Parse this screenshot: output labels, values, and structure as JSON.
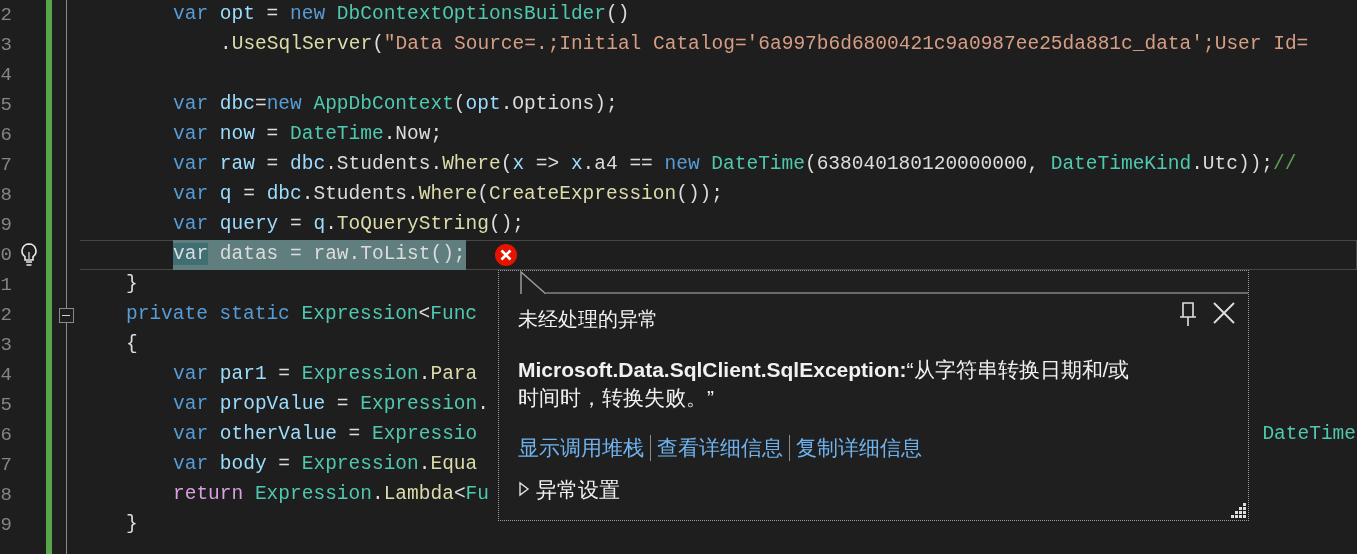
{
  "editor": {
    "lines": [
      {
        "number": "2",
        "kind": "statement",
        "tokens": [
          {
            "text": "var",
            "kind": "keyword"
          },
          {
            "text": " opt",
            "kind": "ident"
          },
          {
            "text": " = ",
            "kind": "plain"
          },
          {
            "text": "new",
            "kind": "keyword"
          },
          {
            "text": " DbContextOptionsBuilder",
            "kind": "type"
          },
          {
            "text": "()",
            "kind": "plain"
          }
        ]
      },
      {
        "number": "3",
        "kind": "continuation",
        "tokens": [
          {
            "text": ".",
            "kind": "plain"
          },
          {
            "text": "UseSqlServer",
            "kind": "method"
          },
          {
            "text": "(",
            "kind": "plain"
          },
          {
            "text": "\"Data Source=.;Initial Catalog='6a997b6d6800421c9a0987ee25da881c_data';User Id=",
            "kind": "string"
          }
        ]
      },
      {
        "number": "4",
        "kind": "blank"
      },
      {
        "number": "5",
        "kind": "statement",
        "tokens": [
          {
            "text": "var",
            "kind": "keyword"
          },
          {
            "text": " dbc",
            "kind": "ident"
          },
          {
            "text": "=",
            "kind": "plain"
          },
          {
            "text": "new",
            "kind": "keyword"
          },
          {
            "text": " AppDbContext",
            "kind": "type"
          },
          {
            "text": "(",
            "kind": "plain"
          },
          {
            "text": "opt",
            "kind": "ident"
          },
          {
            "text": ".Options);",
            "kind": "plain"
          }
        ]
      },
      {
        "number": "6",
        "kind": "statement",
        "tokens": [
          {
            "text": "var",
            "kind": "keyword"
          },
          {
            "text": " now",
            "kind": "ident"
          },
          {
            "text": " = ",
            "kind": "plain"
          },
          {
            "text": "DateTime",
            "kind": "type"
          },
          {
            "text": ".Now;",
            "kind": "plain"
          }
        ]
      },
      {
        "number": "7",
        "kind": "statement",
        "tokens": [
          {
            "text": "var",
            "kind": "keyword"
          },
          {
            "text": " raw",
            "kind": "ident"
          },
          {
            "text": " = ",
            "kind": "plain"
          },
          {
            "text": "dbc",
            "kind": "ident"
          },
          {
            "text": ".Students.",
            "kind": "plain"
          },
          {
            "text": "Where",
            "kind": "method"
          },
          {
            "text": "(",
            "kind": "plain"
          },
          {
            "text": "x",
            "kind": "ident"
          },
          {
            "text": " => ",
            "kind": "plain"
          },
          {
            "text": "x",
            "kind": "ident"
          },
          {
            "text": ".a4 == ",
            "kind": "plain"
          },
          {
            "text": "new",
            "kind": "keyword"
          },
          {
            "text": " DateTime",
            "kind": "type"
          },
          {
            "text": "(638040180120000000, ",
            "kind": "plain"
          },
          {
            "text": "DateTimeKind",
            "kind": "type"
          },
          {
            "text": ".Utc));",
            "kind": "plain"
          },
          {
            "text": "//",
            "kind": "comment"
          }
        ]
      },
      {
        "number": "8",
        "kind": "statement",
        "tokens": [
          {
            "text": "var",
            "kind": "keyword"
          },
          {
            "text": " q",
            "kind": "ident"
          },
          {
            "text": " = ",
            "kind": "plain"
          },
          {
            "text": "dbc",
            "kind": "ident"
          },
          {
            "text": ".Students.",
            "kind": "plain"
          },
          {
            "text": "Where",
            "kind": "method"
          },
          {
            "text": "(",
            "kind": "plain"
          },
          {
            "text": "CreateExpression",
            "kind": "method"
          },
          {
            "text": "());",
            "kind": "plain"
          }
        ]
      },
      {
        "number": "9",
        "kind": "statement",
        "tokens": [
          {
            "text": "var",
            "kind": "keyword"
          },
          {
            "text": " query",
            "kind": "ident"
          },
          {
            "text": " = ",
            "kind": "plain"
          },
          {
            "text": "q",
            "kind": "ident"
          },
          {
            "text": ".",
            "kind": "plain"
          },
          {
            "text": "ToQueryString",
            "kind": "method"
          },
          {
            "text": "();",
            "kind": "plain"
          }
        ]
      },
      {
        "number": "0",
        "kind": "statement",
        "current": true,
        "highlighted": true,
        "lightbulb": true,
        "error": true,
        "tokens": [
          {
            "text": "var",
            "kind": "keyword"
          },
          {
            "text": " datas = raw.ToList();",
            "kind": "plain"
          }
        ]
      },
      {
        "number": "1",
        "kind": "member",
        "tokens": [
          {
            "text": "}",
            "kind": "plain"
          }
        ]
      },
      {
        "number": "2",
        "kind": "member",
        "fold_expanded": true,
        "tokens": [
          {
            "text": "private static",
            "kind": "keyword"
          },
          {
            "text": " Expression",
            "kind": "type"
          },
          {
            "text": "<",
            "kind": "plain"
          },
          {
            "text": "Func",
            "kind": "type"
          }
        ]
      },
      {
        "number": "3",
        "kind": "member",
        "tokens": [
          {
            "text": "{",
            "kind": "plain"
          }
        ]
      },
      {
        "number": "4",
        "kind": "statement",
        "tokens": [
          {
            "text": "var",
            "kind": "keyword"
          },
          {
            "text": " par1",
            "kind": "ident"
          },
          {
            "text": " = ",
            "kind": "plain"
          },
          {
            "text": "Expression",
            "kind": "type"
          },
          {
            "text": ".",
            "kind": "plain"
          },
          {
            "text": "Para",
            "kind": "method"
          }
        ]
      },
      {
        "number": "5",
        "kind": "statement",
        "tokens": [
          {
            "text": "var",
            "kind": "keyword"
          },
          {
            "text": " propValue",
            "kind": "ident"
          },
          {
            "text": " = ",
            "kind": "plain"
          },
          {
            "text": "Expression",
            "kind": "type"
          },
          {
            "text": ".",
            "kind": "plain"
          }
        ]
      },
      {
        "number": "6",
        "kind": "statement",
        "tokens": [
          {
            "text": "var",
            "kind": "keyword"
          },
          {
            "text": " otherValue",
            "kind": "ident"
          },
          {
            "text": " = ",
            "kind": "plain"
          },
          {
            "text": "Expressio",
            "kind": "type"
          }
        ],
        "tail": {
          "text": "DateTime",
          "kind": "type"
        }
      },
      {
        "number": "7",
        "kind": "statement",
        "tokens": [
          {
            "text": "var",
            "kind": "keyword"
          },
          {
            "text": " body",
            "kind": "ident"
          },
          {
            "text": " = ",
            "kind": "plain"
          },
          {
            "text": "Expression",
            "kind": "type"
          },
          {
            "text": ".",
            "kind": "plain"
          },
          {
            "text": "Equa",
            "kind": "method"
          }
        ]
      },
      {
        "number": "8",
        "kind": "statement",
        "tokens": [
          {
            "text": "return",
            "kind": "control"
          },
          {
            "text": " Expression",
            "kind": "type"
          },
          {
            "text": ".",
            "kind": "plain"
          },
          {
            "text": "Lambda",
            "kind": "method"
          },
          {
            "text": "<",
            "kind": "plain"
          },
          {
            "text": "Fu",
            "kind": "type"
          }
        ]
      },
      {
        "number": "9",
        "kind": "member",
        "tokens": [
          {
            "text": "}",
            "kind": "plain"
          }
        ]
      }
    ]
  },
  "exception_popup": {
    "title": "未经处理的异常",
    "message": "**Microsoft.Data.SqlClient.SqlException:**“从字符串转换日期和/或时间时，转换失败。”",
    "links": [
      "显示调用堆栈",
      "查看详细信息",
      "复制详细信息"
    ],
    "settings": {
      "label": "异常设置",
      "expanded": false
    }
  }
}
